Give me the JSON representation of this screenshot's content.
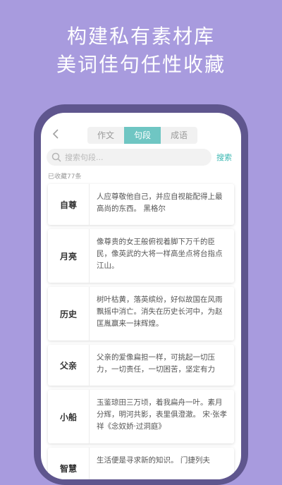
{
  "headline": {
    "line1": "构建私有素材库",
    "line2": "美词佳句任性收藏"
  },
  "tabs": [
    {
      "label": "作文",
      "active": false
    },
    {
      "label": "句段",
      "active": true
    },
    {
      "label": "成语",
      "active": false
    }
  ],
  "search": {
    "placeholder": "搜索句段...",
    "button": "搜索"
  },
  "count_text": "已收藏77条",
  "items": [
    {
      "word": "自尊",
      "text": "人应尊敬他自己，并应自视能配得上最高尚的东西。 黑格尔"
    },
    {
      "word": "月亮",
      "text": "像尊贵的女王般俯视着脚下万千的臣民，像英武的大将一样高坐点将台指点江山。"
    },
    {
      "word": "历史",
      "text": "树叶枯黄，落英缤纷，好似故国在风雨飘摇中消亡。消失在历史长河中，为赵匡胤赢来一抹辉煌。"
    },
    {
      "word": "父亲",
      "text": "父亲的爱像扁担一样，可挑起一切压力，一切责任，一切困苦，坚定有力"
    },
    {
      "word": "小船",
      "text": "玉鉴琼田三万顷，着我扁舟一叶。素月分辉，明河共影，表里俱澄澈。 宋·张孝祥《念奴娇·过洞庭》"
    },
    {
      "word": "智慧",
      "text": "生活便是寻求新的知识。 门捷列夫"
    }
  ],
  "colors": {
    "background": "#a89bde",
    "phone_frame": "#5f568e",
    "tab_active": "#6fc6c3",
    "search_button": "#39b7b1"
  },
  "icons": {
    "back": "chevron-left-icon",
    "search": "search-icon"
  }
}
